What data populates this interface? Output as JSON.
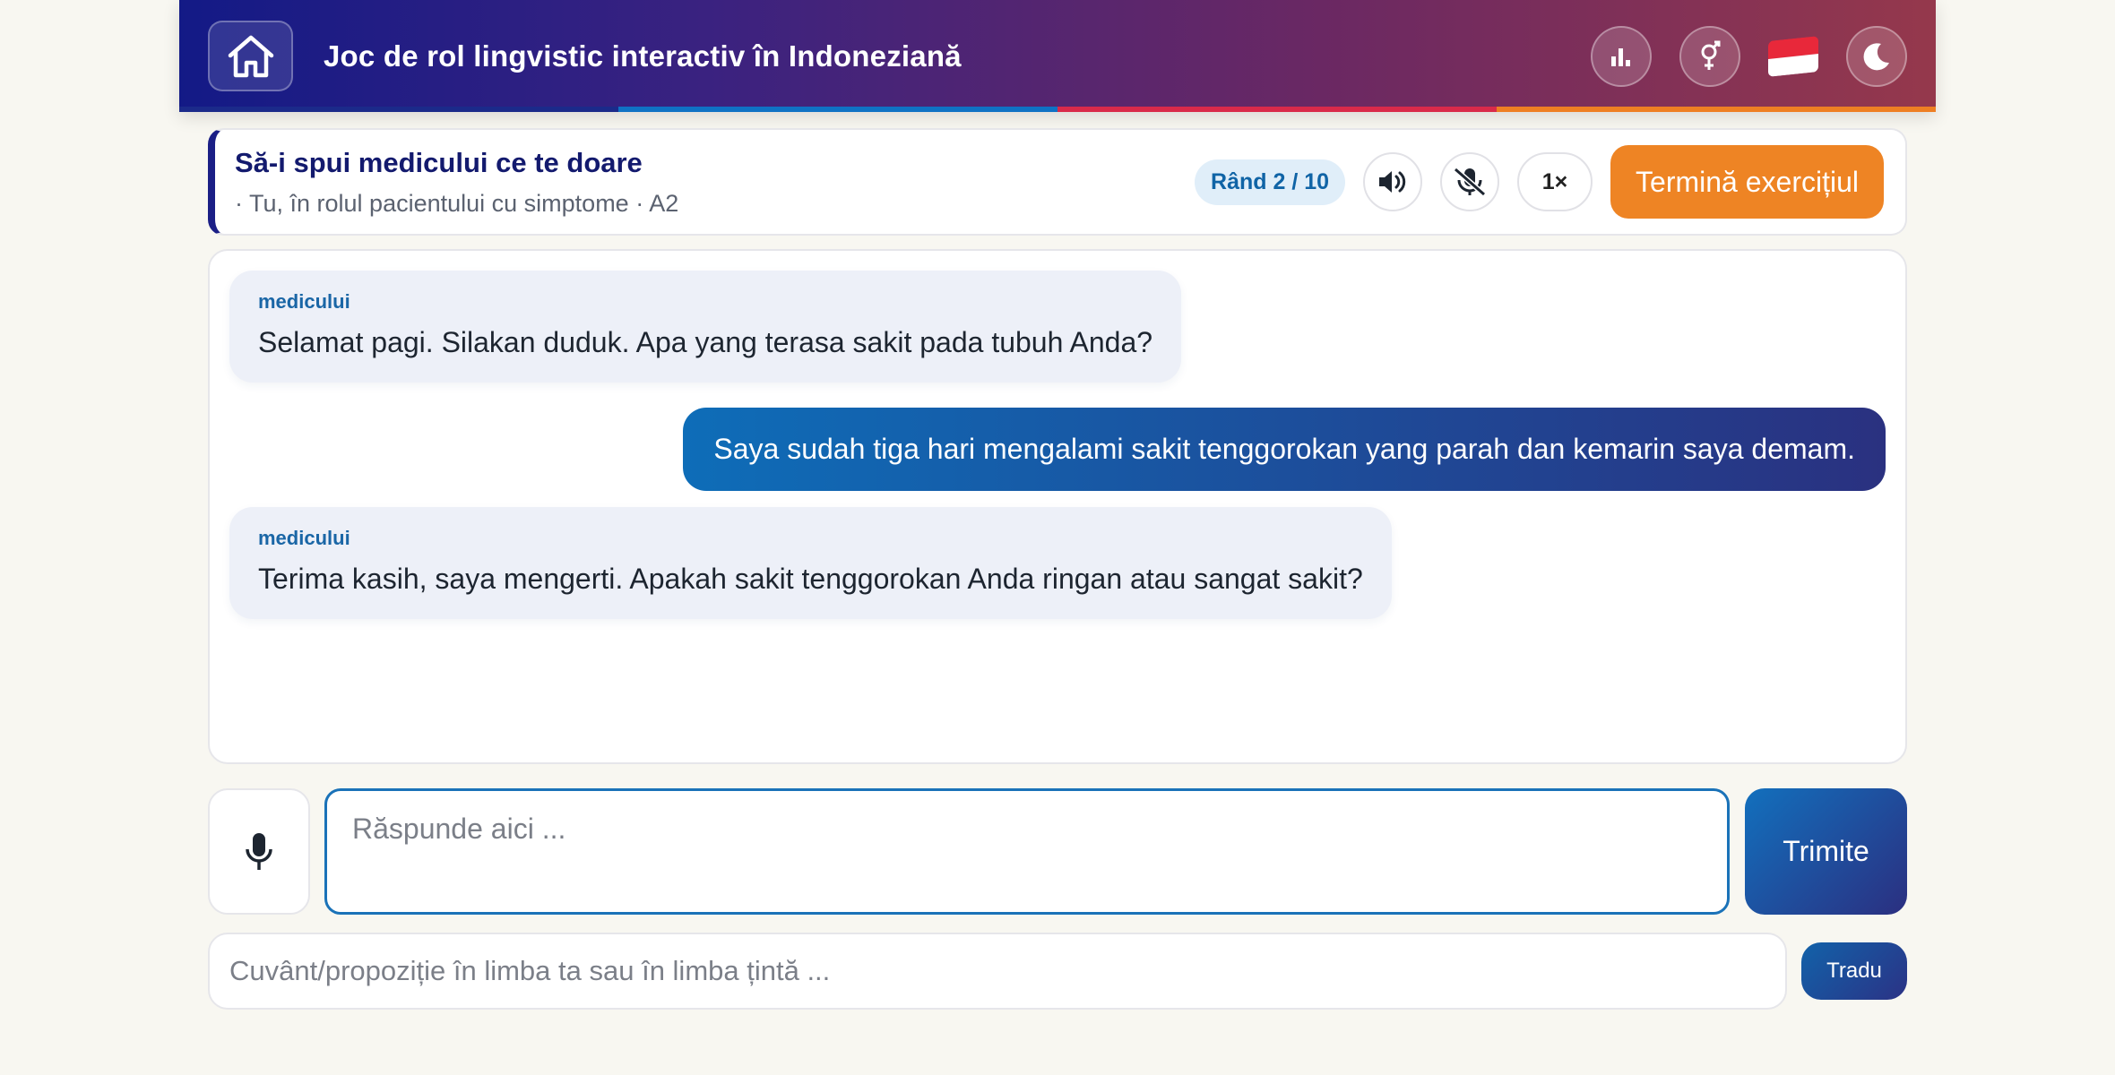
{
  "header": {
    "title": "Joc de rol lingvistic interactiv în Indoneziană",
    "stripe_colors": [
      "#1b2a8a",
      "#0f72c4",
      "#d92a4a",
      "#ee7f23"
    ],
    "icons": [
      "home-icon",
      "chart-icon",
      "gender-icon",
      "indonesia-flag-icon",
      "moon-icon"
    ]
  },
  "scenario": {
    "title": "Să-i spui medicului ce te doare",
    "subtitle": "· Tu, în rolul pacientului cu simptome · A2",
    "round_label": "Rând 2 / 10",
    "speed_label": "1×",
    "finish_label": "Termină exercițiul",
    "icons": [
      "speaker-icon",
      "mute-microphone-icon"
    ]
  },
  "chat": {
    "messages": [
      {
        "side": "left",
        "speaker": "medicului",
        "text": "Selamat pagi. Silakan duduk. Apa yang terasa sakit pada tubuh Anda?"
      },
      {
        "side": "right",
        "text": "Saya sudah tiga hari mengalami sakit tenggorokan yang parah dan kemarin saya demam."
      },
      {
        "side": "left",
        "speaker": "medicului",
        "text": "Terima kasih, saya mengerti. Apakah sakit tenggorokan Anda ringan atau sangat sakit?"
      }
    ]
  },
  "input": {
    "reply_placeholder": "Răspunde aici ...",
    "reply_value": "",
    "send_label": "Trimite",
    "translate_placeholder": "Cuvânt/propoziție în limba ta sau în limba țintă ...",
    "translate_label": "Tradu"
  },
  "colors": {
    "accent_orange": "#ee8424",
    "accent_blue": "#1270bd",
    "navy": "#131a86"
  }
}
